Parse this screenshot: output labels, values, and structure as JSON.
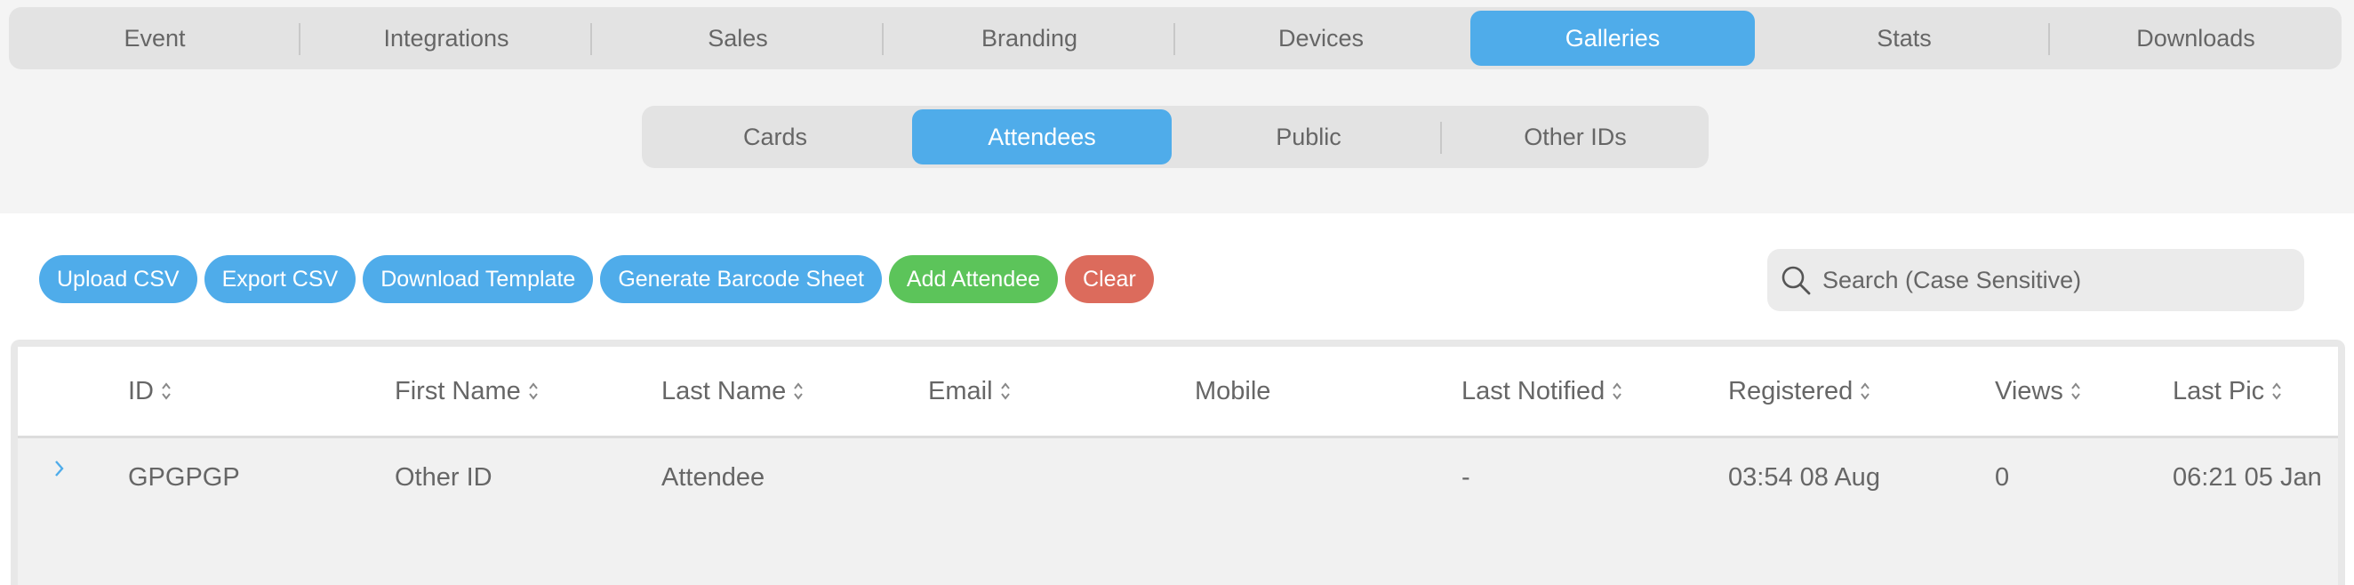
{
  "nav": {
    "tabs": [
      "Event",
      "Integrations",
      "Sales",
      "Branding",
      "Devices",
      "Galleries",
      "Stats",
      "Downloads"
    ],
    "active": "Galleries"
  },
  "subnav": {
    "tabs": [
      "Cards",
      "Attendees",
      "Public",
      "Other IDs"
    ],
    "active": "Attendees"
  },
  "toolbar": {
    "upload_csv": "Upload CSV",
    "export_csv": "Export CSV",
    "download_template": "Download Template",
    "generate_barcode_sheet": "Generate Barcode Sheet",
    "add_attendee": "Add Attendee",
    "clear": "Clear"
  },
  "search": {
    "placeholder": "Search (Case Sensitive)",
    "value": ""
  },
  "table": {
    "columns": [
      "ID",
      "First Name",
      "Last Name",
      "Email",
      "Mobile",
      "Last Notified",
      "Registered",
      "Views",
      "Last Pic"
    ],
    "rows": [
      {
        "id": "GPGPGP",
        "first_name": "Other ID",
        "last_name": "Attendee",
        "email": "",
        "mobile": "",
        "last_notified": "-",
        "registered": "03:54 08 Aug",
        "views": "0",
        "last_pic": "06:21 05 Jan"
      }
    ]
  },
  "colors": {
    "accent": "#4facea",
    "success": "#5cc45a",
    "danger": "#dc6b5c"
  }
}
